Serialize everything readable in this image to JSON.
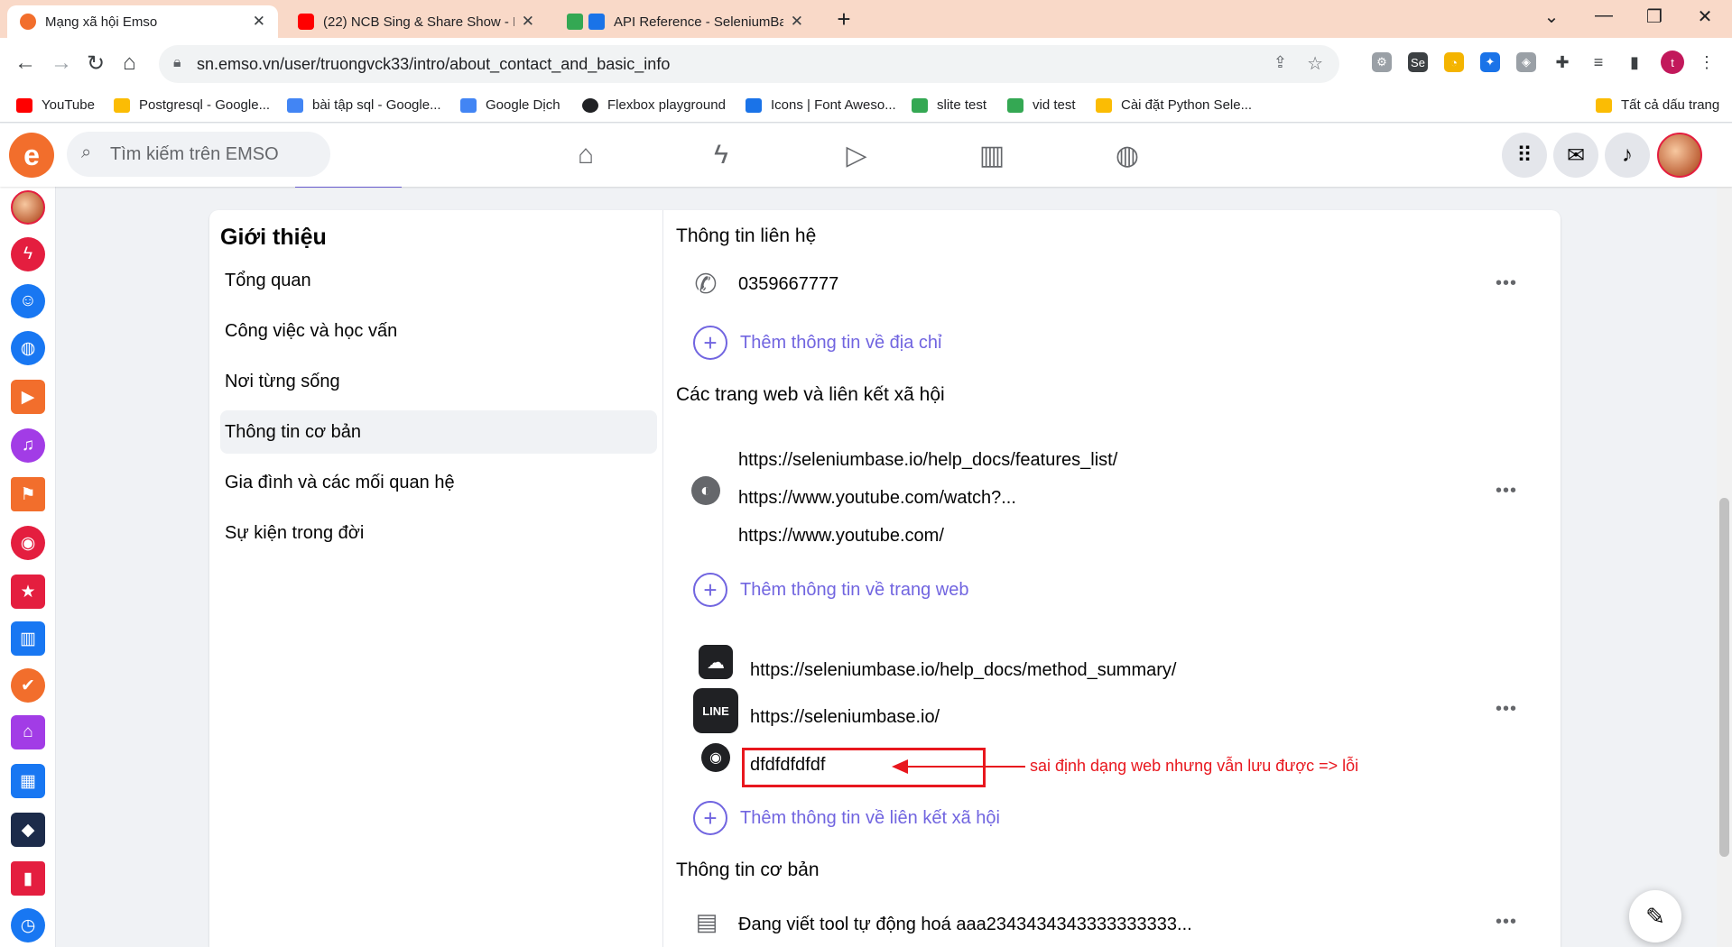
{
  "browser": {
    "tabs": [
      {
        "title": "Mạng xã hội Emso",
        "color": "#f26e2c"
      },
      {
        "title": "(22) NCB Sing & Share Show - M",
        "color": "#ff0000"
      },
      {
        "title": "API Reference - SeleniumBas",
        "color": "#1a73e8"
      }
    ],
    "new_tab": "+",
    "url": "sn.emso.vn/user/truongvck33/intro/about_contact_and_basic_info",
    "profile_initial": "t",
    "bookmarks": [
      {
        "label": "YouTube",
        "color": "#ff0000"
      },
      {
        "label": "Postgresql - Google...",
        "color": "#fbbc04"
      },
      {
        "label": "bài tập sql - Google...",
        "color": "#4285f4"
      },
      {
        "label": "Google Dịch",
        "color": "#4285f4"
      },
      {
        "label": "Flexbox playground",
        "color": "#202124"
      },
      {
        "label": "Icons | Font Aweso...",
        "color": "#1a73e8"
      },
      {
        "label": "slite test",
        "color": "#34a853"
      },
      {
        "label": "vid test",
        "color": "#34a853"
      },
      {
        "label": "Cài đặt Python Sele...",
        "color": "#fbbc04"
      }
    ],
    "all_bookmarks": "Tất cả dấu trang"
  },
  "header": {
    "logo": "e",
    "search_placeholder": "Tìm kiếm trên EMSO"
  },
  "about": {
    "title": "Giới thiệu",
    "menu": [
      "Tổng quan",
      "Công việc và học vấn",
      "Nơi từng sống",
      "Thông tin cơ bản",
      "Gia đình và các mối quan hệ",
      "Sự kiện trong đời"
    ],
    "active_index": 3
  },
  "contact": {
    "title": "Thông tin liên hệ",
    "phone": "0359667777",
    "add_address": "Thêm thông tin về địa chỉ"
  },
  "websites": {
    "title": "Các trang web và liên kết xã hội",
    "links": [
      "https://seleniumbase.io/help_docs/features_list/",
      "https://www.youtube.com/watch?...",
      "https://www.youtube.com/"
    ],
    "add_website": "Thêm thông tin về trang web",
    "social": [
      {
        "icon": "wechat-icon",
        "text": "https://seleniumbase.io/help_docs/method_summary/"
      },
      {
        "icon": "line-icon",
        "text": "https://seleniumbase.io/"
      },
      {
        "icon": "instagram-icon",
        "text": "dfdfdfdfdf"
      }
    ],
    "add_social": "Thêm thông tin về liên kết xã hội"
  },
  "basic": {
    "title": "Thông tin cơ bản",
    "bio": "Đang viết tool tự động hoá aaa2343434343333333333..."
  },
  "annotation": {
    "text": "sai định dạng web nhưng vẫn lưu được => lỗi",
    "color": "#e8171e"
  },
  "more_label": "•••",
  "accent": "#7165e0"
}
